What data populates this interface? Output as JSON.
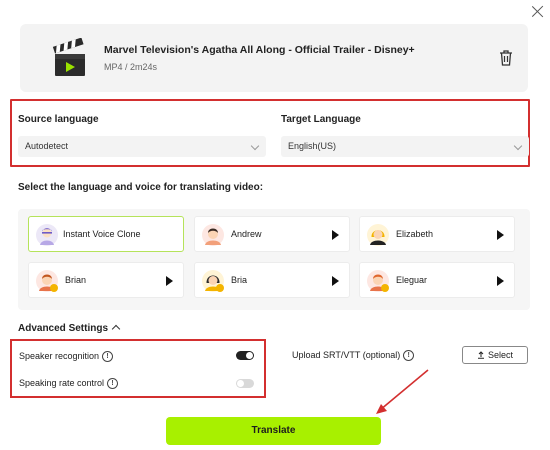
{
  "file": {
    "title": "Marvel Television's Agatha All Along - Official Trailer - Disney+",
    "meta": "MP4 / 2m24s"
  },
  "languages": {
    "source_label": "Source language",
    "source_value": "Autodetect",
    "target_label": "Target Language",
    "target_value": "English(US)"
  },
  "voice_section": {
    "heading": "Select the language and voice for translating video:",
    "voices": [
      {
        "name": "Instant Voice Clone",
        "selected": true
      },
      {
        "name": "Andrew"
      },
      {
        "name": "Elizabeth"
      },
      {
        "name": "Brian"
      },
      {
        "name": "Bria"
      },
      {
        "name": "Eleguar"
      }
    ]
  },
  "advanced": {
    "heading": "Advanced Settings",
    "speaker_recognition": {
      "label": "Speaker recognition",
      "enabled": true
    },
    "speaking_rate": {
      "label": "Speaking rate control",
      "enabled": false
    },
    "upload_label": "Upload SRT/VTT (optional)",
    "select_label": "Select",
    "info_glyph": "!"
  },
  "action": {
    "translate_label": "Translate"
  },
  "colors": {
    "accent": "#a8f000",
    "highlight": "#d32f2f"
  }
}
